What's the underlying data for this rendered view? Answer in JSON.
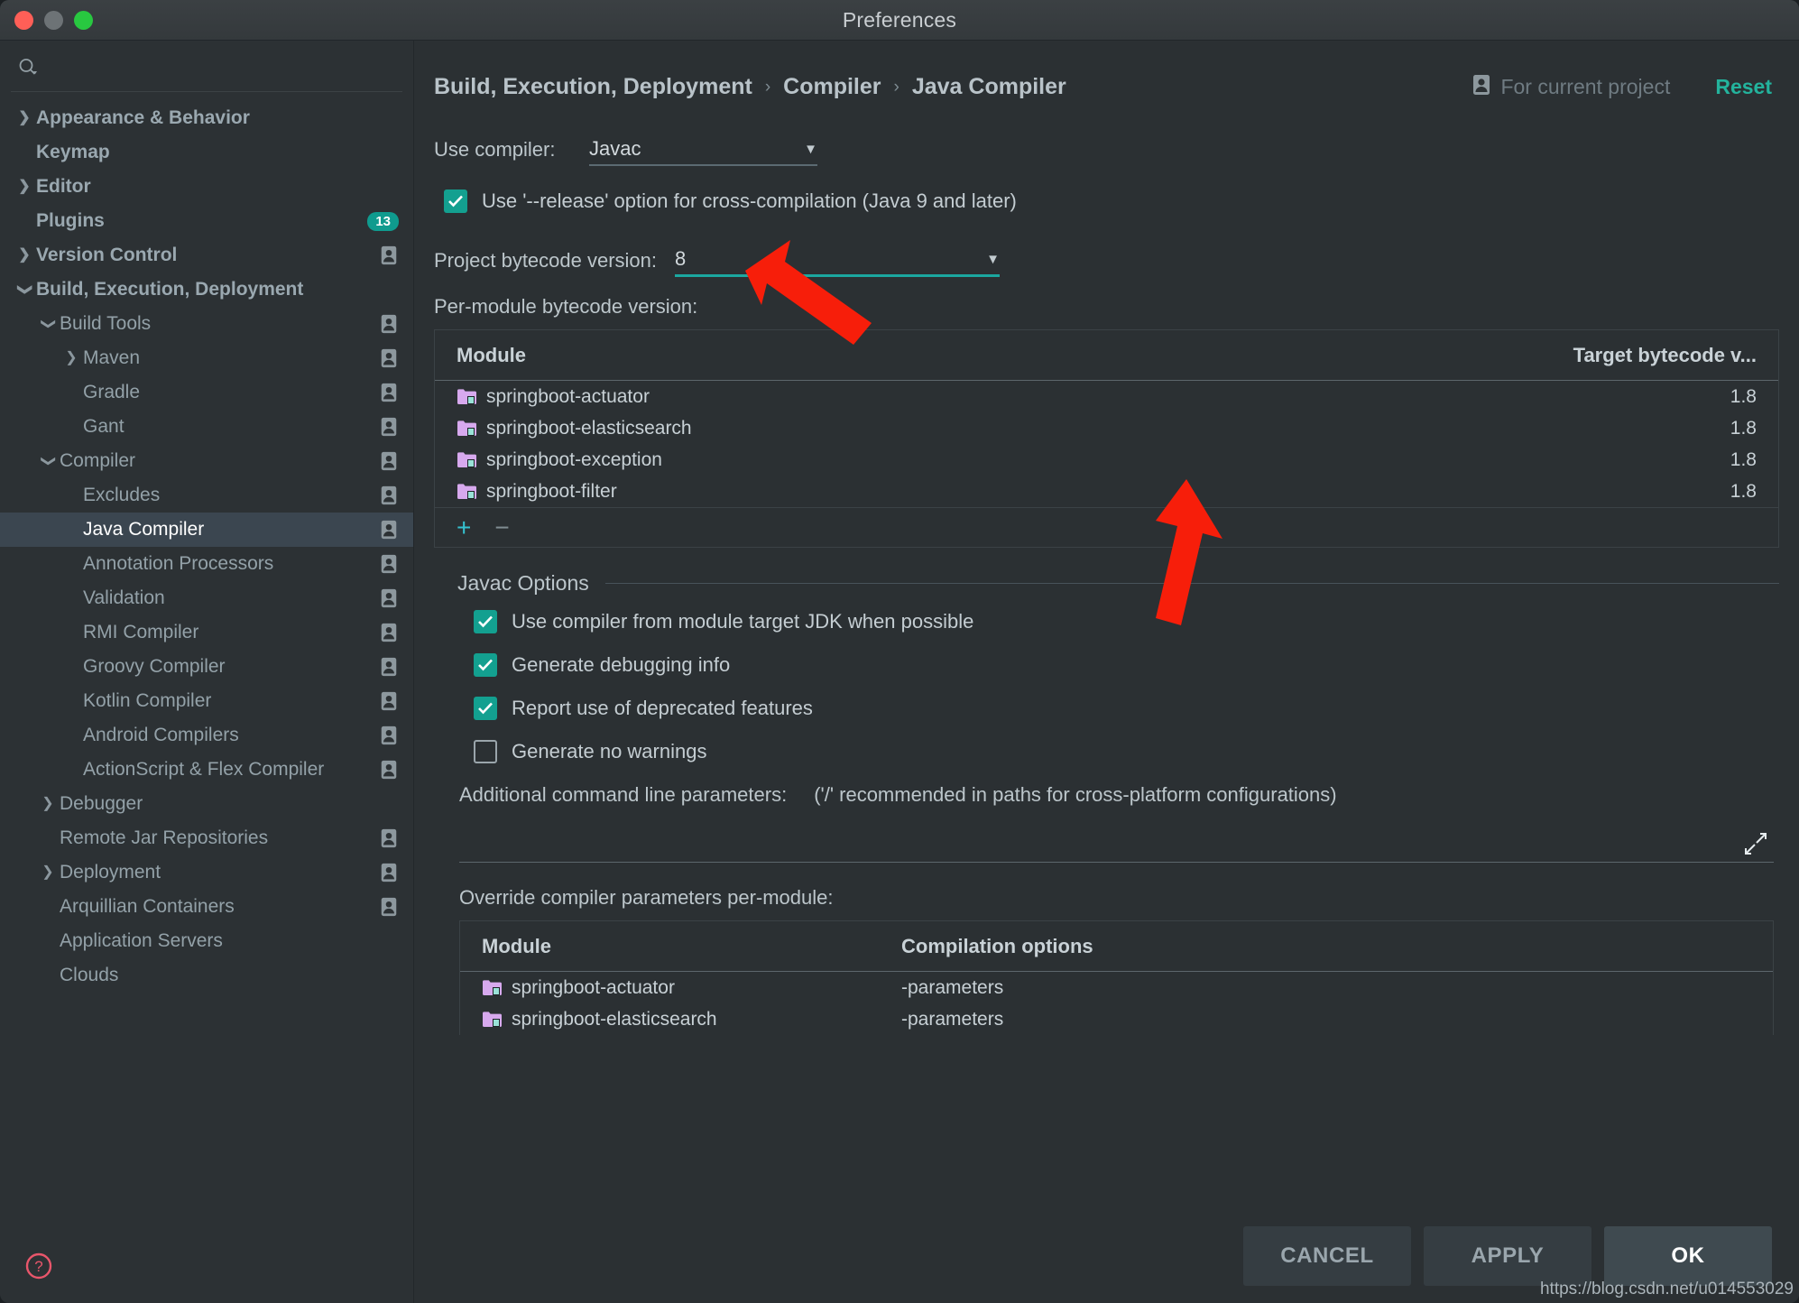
{
  "window": {
    "title": "Preferences",
    "traffic_lights": [
      "close",
      "minimize",
      "zoom"
    ]
  },
  "sidebar": {
    "search_placeholder": "",
    "search_value": "",
    "items": [
      {
        "label": "Appearance & Behavior",
        "arrow": "collapsed",
        "indent": 0,
        "bold": true,
        "person": false,
        "badge": null,
        "selected": false
      },
      {
        "label": "Keymap",
        "arrow": "none",
        "indent": 0,
        "bold": true,
        "person": false,
        "badge": null,
        "selected": false
      },
      {
        "label": "Editor",
        "arrow": "collapsed",
        "indent": 0,
        "bold": true,
        "person": false,
        "badge": null,
        "selected": false
      },
      {
        "label": "Plugins",
        "arrow": "none",
        "indent": 0,
        "bold": true,
        "person": false,
        "badge": "13",
        "selected": false
      },
      {
        "label": "Version Control",
        "arrow": "collapsed",
        "indent": 0,
        "bold": true,
        "person": true,
        "badge": null,
        "selected": false
      },
      {
        "label": "Build, Execution, Deployment",
        "arrow": "expanded",
        "indent": 0,
        "bold": true,
        "person": false,
        "badge": null,
        "selected": false
      },
      {
        "label": "Build Tools",
        "arrow": "expanded",
        "indent": 1,
        "bold": false,
        "person": true,
        "badge": null,
        "selected": false
      },
      {
        "label": "Maven",
        "arrow": "collapsed",
        "indent": 2,
        "bold": false,
        "person": true,
        "badge": null,
        "selected": false
      },
      {
        "label": "Gradle",
        "arrow": "none",
        "indent": 2,
        "bold": false,
        "person": true,
        "badge": null,
        "selected": false
      },
      {
        "label": "Gant",
        "arrow": "none",
        "indent": 2,
        "bold": false,
        "person": true,
        "badge": null,
        "selected": false
      },
      {
        "label": "Compiler",
        "arrow": "expanded",
        "indent": 1,
        "bold": false,
        "person": true,
        "badge": null,
        "selected": false
      },
      {
        "label": "Excludes",
        "arrow": "none",
        "indent": 2,
        "bold": false,
        "person": true,
        "badge": null,
        "selected": false
      },
      {
        "label": "Java Compiler",
        "arrow": "none",
        "indent": 2,
        "bold": false,
        "person": true,
        "badge": null,
        "selected": true
      },
      {
        "label": "Annotation Processors",
        "arrow": "none",
        "indent": 2,
        "bold": false,
        "person": true,
        "badge": null,
        "selected": false
      },
      {
        "label": "Validation",
        "arrow": "none",
        "indent": 2,
        "bold": false,
        "person": true,
        "badge": null,
        "selected": false
      },
      {
        "label": "RMI Compiler",
        "arrow": "none",
        "indent": 2,
        "bold": false,
        "person": true,
        "badge": null,
        "selected": false
      },
      {
        "label": "Groovy Compiler",
        "arrow": "none",
        "indent": 2,
        "bold": false,
        "person": true,
        "badge": null,
        "selected": false
      },
      {
        "label": "Kotlin Compiler",
        "arrow": "none",
        "indent": 2,
        "bold": false,
        "person": true,
        "badge": null,
        "selected": false
      },
      {
        "label": "Android Compilers",
        "arrow": "none",
        "indent": 2,
        "bold": false,
        "person": true,
        "badge": null,
        "selected": false
      },
      {
        "label": "ActionScript & Flex Compiler",
        "arrow": "none",
        "indent": 2,
        "bold": false,
        "person": true,
        "badge": null,
        "selected": false
      },
      {
        "label": "Debugger",
        "arrow": "collapsed",
        "indent": 1,
        "bold": false,
        "person": false,
        "badge": null,
        "selected": false
      },
      {
        "label": "Remote Jar Repositories",
        "arrow": "none",
        "indent": 1,
        "bold": false,
        "person": true,
        "badge": null,
        "selected": false
      },
      {
        "label": "Deployment",
        "arrow": "collapsed",
        "indent": 1,
        "bold": false,
        "person": true,
        "badge": null,
        "selected": false
      },
      {
        "label": "Arquillian Containers",
        "arrow": "none",
        "indent": 1,
        "bold": false,
        "person": true,
        "badge": null,
        "selected": false
      },
      {
        "label": "Application Servers",
        "arrow": "none",
        "indent": 1,
        "bold": false,
        "person": false,
        "badge": null,
        "selected": false
      },
      {
        "label": "Clouds",
        "arrow": "none",
        "indent": 1,
        "bold": false,
        "person": false,
        "badge": null,
        "selected": false
      }
    ],
    "help_icon": "question-mark-circle"
  },
  "header": {
    "breadcrumb": [
      "Build, Execution, Deployment",
      "Compiler",
      "Java Compiler"
    ],
    "separator": "›",
    "scope_label": "For current project",
    "scope_icon": "person-icon",
    "reset_label": "Reset"
  },
  "settings": {
    "use_compiler_label": "Use compiler:",
    "use_compiler_value": "Javac",
    "release_option_label": "Use '--release' option for cross-compilation (Java 9 and later)",
    "release_option_checked": true,
    "project_bytecode_label": "Project bytecode version:",
    "project_bytecode_value": "8",
    "per_module_label": "Per-module bytecode version:",
    "bytecode_table": {
      "columns": [
        "Module",
        "Target bytecode v..."
      ],
      "rows": [
        {
          "module": "springboot-actuator",
          "target": "1.8"
        },
        {
          "module": "springboot-elasticsearch",
          "target": "1.8"
        },
        {
          "module": "springboot-exception",
          "target": "1.8"
        },
        {
          "module": "springboot-filter",
          "target": "1.8"
        }
      ],
      "add_label": "+",
      "remove_label": "−"
    }
  },
  "javac_options": {
    "section_title": "Javac Options",
    "checkboxes": [
      {
        "label": "Use compiler from module target JDK when possible",
        "checked": true
      },
      {
        "label": "Generate debugging info",
        "checked": true
      },
      {
        "label": "Report use of deprecated features",
        "checked": true
      },
      {
        "label": "Generate no warnings",
        "checked": false
      }
    ],
    "additional_params_label": "Additional command line parameters:",
    "additional_params_hint": "('/' recommended in paths for cross-platform configurations)",
    "additional_params_value": "",
    "expand_icon": "expand-arrows-icon",
    "override_label": "Override compiler parameters per-module:",
    "override_table": {
      "columns": [
        "Module",
        "Compilation options"
      ],
      "rows": [
        {
          "module": "springboot-actuator",
          "options": "-parameters"
        },
        {
          "module": "springboot-elasticsearch",
          "options": "-parameters"
        }
      ]
    }
  },
  "footer": {
    "cancel_label": "CANCEL",
    "apply_label": "APPLY",
    "ok_label": "OK",
    "watermark": "https://blog.csdn.net/u014553029"
  },
  "annotations": {
    "arrow_color": "#f71e0a",
    "arrow_count": 2
  }
}
